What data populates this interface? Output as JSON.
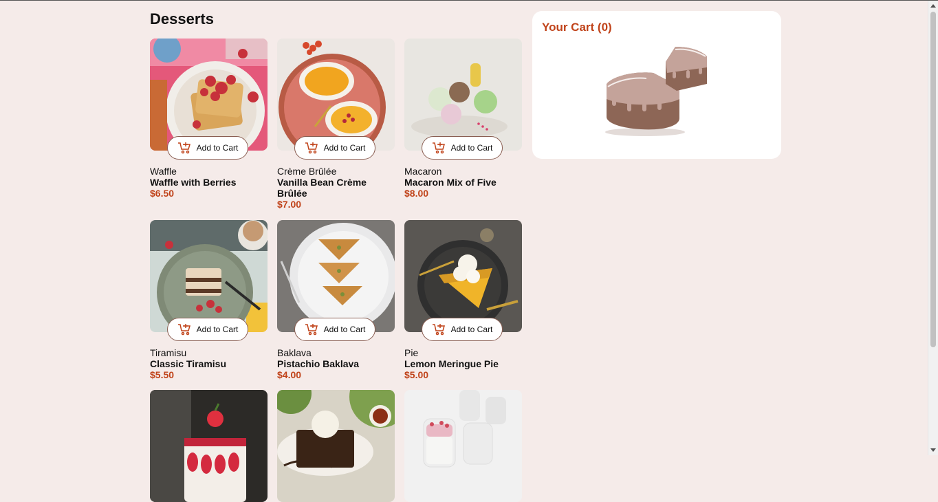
{
  "page": {
    "title": "Desserts"
  },
  "products": [
    {
      "category": "Waffle",
      "name": "Waffle with Berries",
      "price": "$6.50",
      "button": "Add to Cart",
      "image": "waffle-photo"
    },
    {
      "category": "Crème Brûlée",
      "name": "Vanilla Bean Crème Brûlée",
      "price": "$7.00",
      "button": "Add to Cart",
      "image": "creme-brulee-photo"
    },
    {
      "category": "Macaron",
      "name": "Macaron Mix of Five",
      "price": "$8.00",
      "button": "Add to Cart",
      "image": "macaron-photo"
    },
    {
      "category": "Tiramisu",
      "name": "Classic Tiramisu",
      "price": "$5.50",
      "button": "Add to Cart",
      "image": "tiramisu-photo"
    },
    {
      "category": "Baklava",
      "name": "Pistachio Baklava",
      "price": "$4.00",
      "button": "Add to Cart",
      "image": "baklava-photo"
    },
    {
      "category": "Pie",
      "name": "Lemon Meringue Pie",
      "price": "$5.00",
      "button": "Add to Cart",
      "image": "pie-photo"
    },
    {
      "image": "red-velvet-cake-photo"
    },
    {
      "image": "brownie-photo"
    },
    {
      "image": "panna-cotta-photo"
    }
  ],
  "cart": {
    "title": "Your Cart (0)",
    "illustration": "empty-cart-cake-illustration"
  },
  "colors": {
    "background": "#f5ebe9",
    "accent": "#c0431a",
    "button_border": "#8a5e52",
    "card": "#ffffff"
  },
  "icons": {
    "add_to_cart": "cart-plus-icon"
  }
}
